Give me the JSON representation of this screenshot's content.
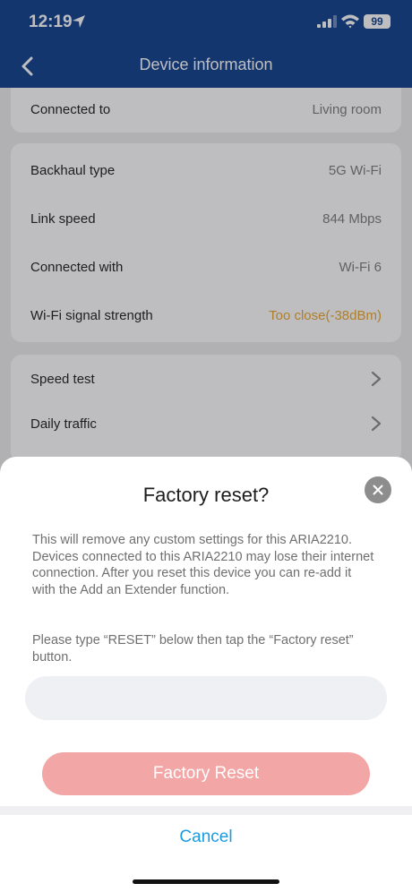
{
  "status_bar": {
    "time": "12:19",
    "battery": "99"
  },
  "header": {
    "title": "Device information"
  },
  "device_info": {
    "connected_to": {
      "label": "Connected to",
      "value": "Living room"
    },
    "backhaul": [
      {
        "label": "Backhaul type",
        "value": "5G Wi-Fi"
      },
      {
        "label": "Link speed",
        "value": "844 Mbps"
      },
      {
        "label": "Connected with",
        "value": "Wi-Fi 6"
      },
      {
        "label": "Wi-Fi signal strength",
        "value": "Too close(-38dBm)"
      }
    ],
    "links": [
      {
        "label": "Speed test"
      },
      {
        "label": "Daily traffic"
      }
    ]
  },
  "dialog": {
    "title": "Factory reset?",
    "description": "This will remove any custom settings for this ARIA2210. Devices connected to this ARIA2210 may lose their internet connection. After you reset this device you can re-add it with the Add an Extender function.",
    "instruction": "Please type “RESET” below then tap the “Factory reset” button.",
    "input_value": "",
    "factory_reset_label": "Factory Reset",
    "cancel_label": "Cancel"
  },
  "colors": {
    "header_bg": "#0b3d8c",
    "warning_text": "#e8a52a",
    "reset_button_bg": "#f3a6a6",
    "cancel_text": "#1a9be2"
  }
}
